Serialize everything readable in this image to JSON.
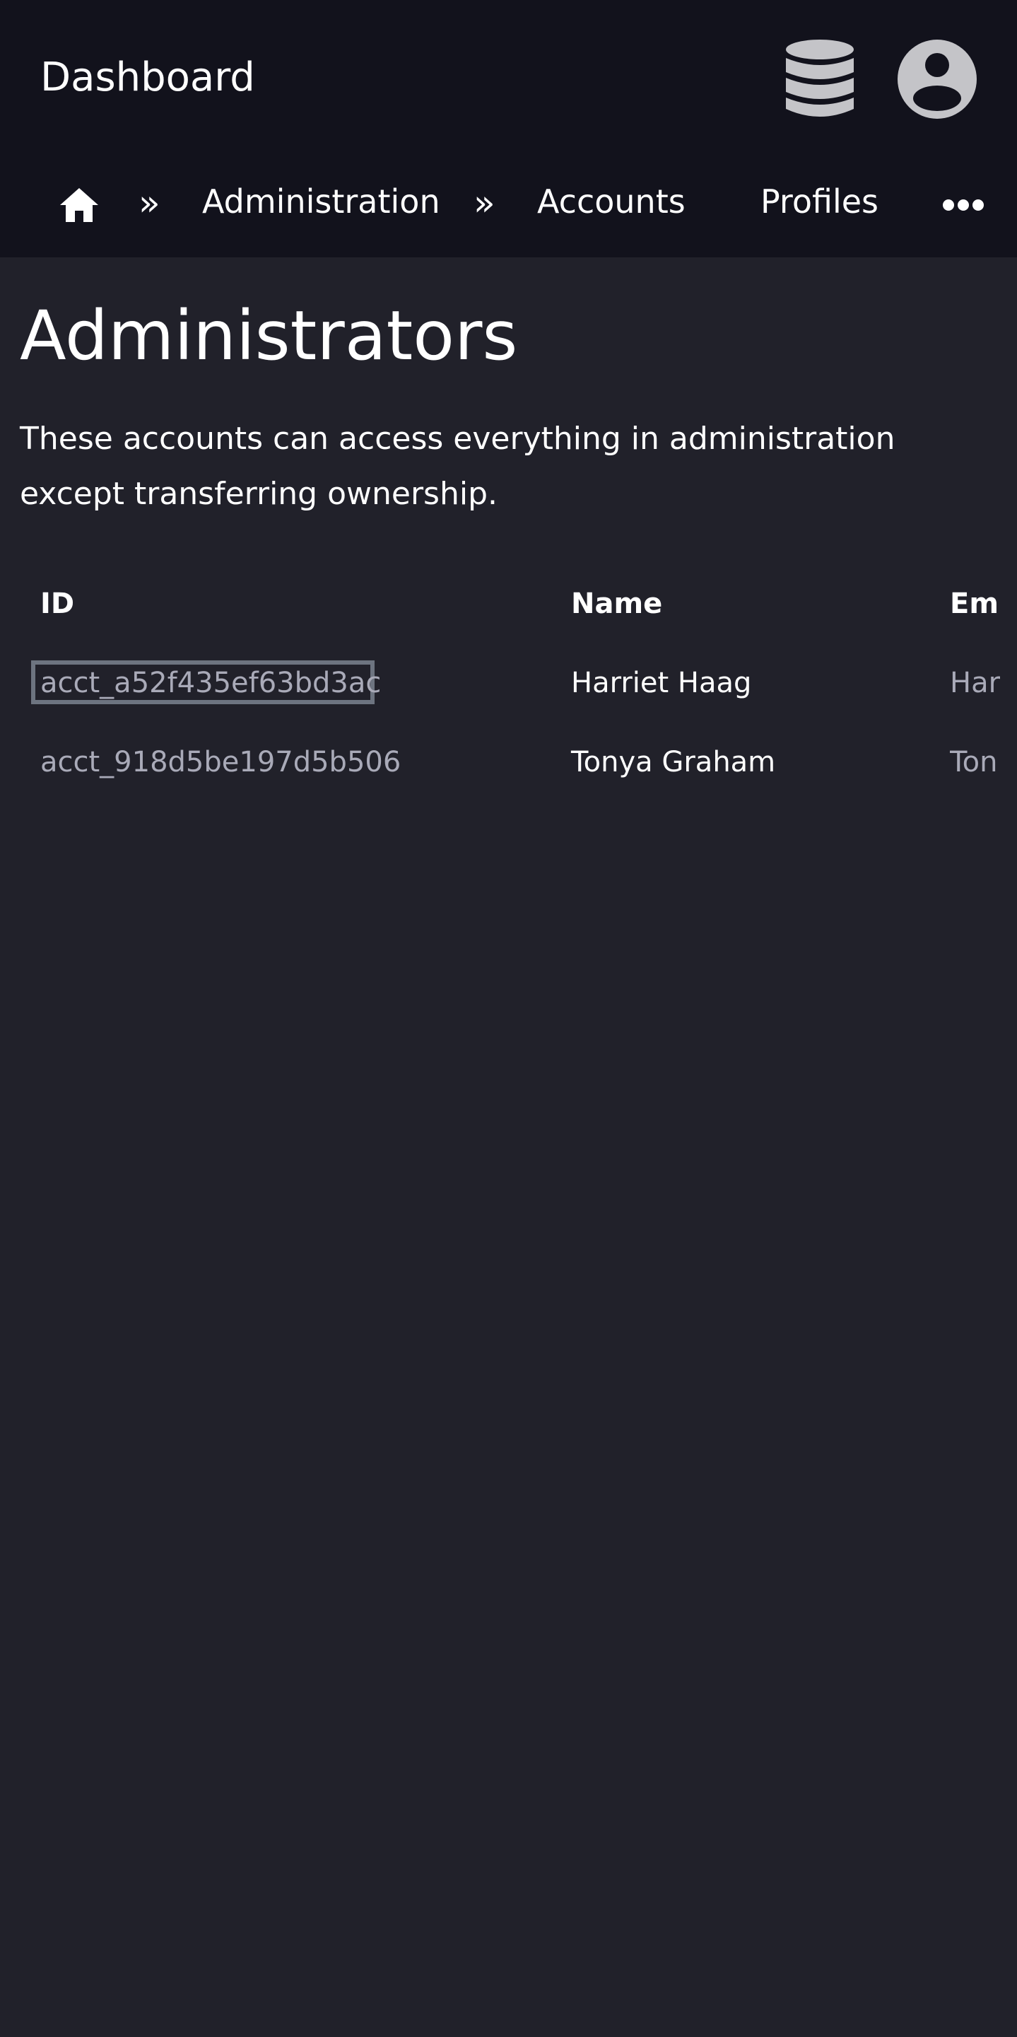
{
  "header": {
    "app_title": "Dashboard",
    "icons": {
      "database": "database-icon",
      "user": "user-circle-icon"
    }
  },
  "breadcrumb": {
    "home_icon": "home-icon",
    "separator": "»",
    "items": [
      {
        "label": "Administration"
      },
      {
        "label": "Accounts"
      },
      {
        "label": "Profiles"
      }
    ],
    "more_icon": "ellipsis-icon"
  },
  "page": {
    "title": "Administrators",
    "description": "These accounts can access everything in administration except transferring ownership."
  },
  "table": {
    "columns": [
      "ID",
      "Name",
      "Em"
    ],
    "rows": [
      {
        "id": "acct_a52f435ef63bd3ac",
        "name": "Harriet Haag",
        "email": "Har"
      },
      {
        "id": "acct_918d5be197d5b506",
        "name": "Tonya Graham",
        "email": "Ton"
      }
    ]
  },
  "colors": {
    "topbar_bg": "#12121c",
    "page_bg": "#21212a",
    "muted_text": "#a9aab8",
    "icon_gray": "#c4c4c8",
    "focus_ring": "#6d7480"
  }
}
